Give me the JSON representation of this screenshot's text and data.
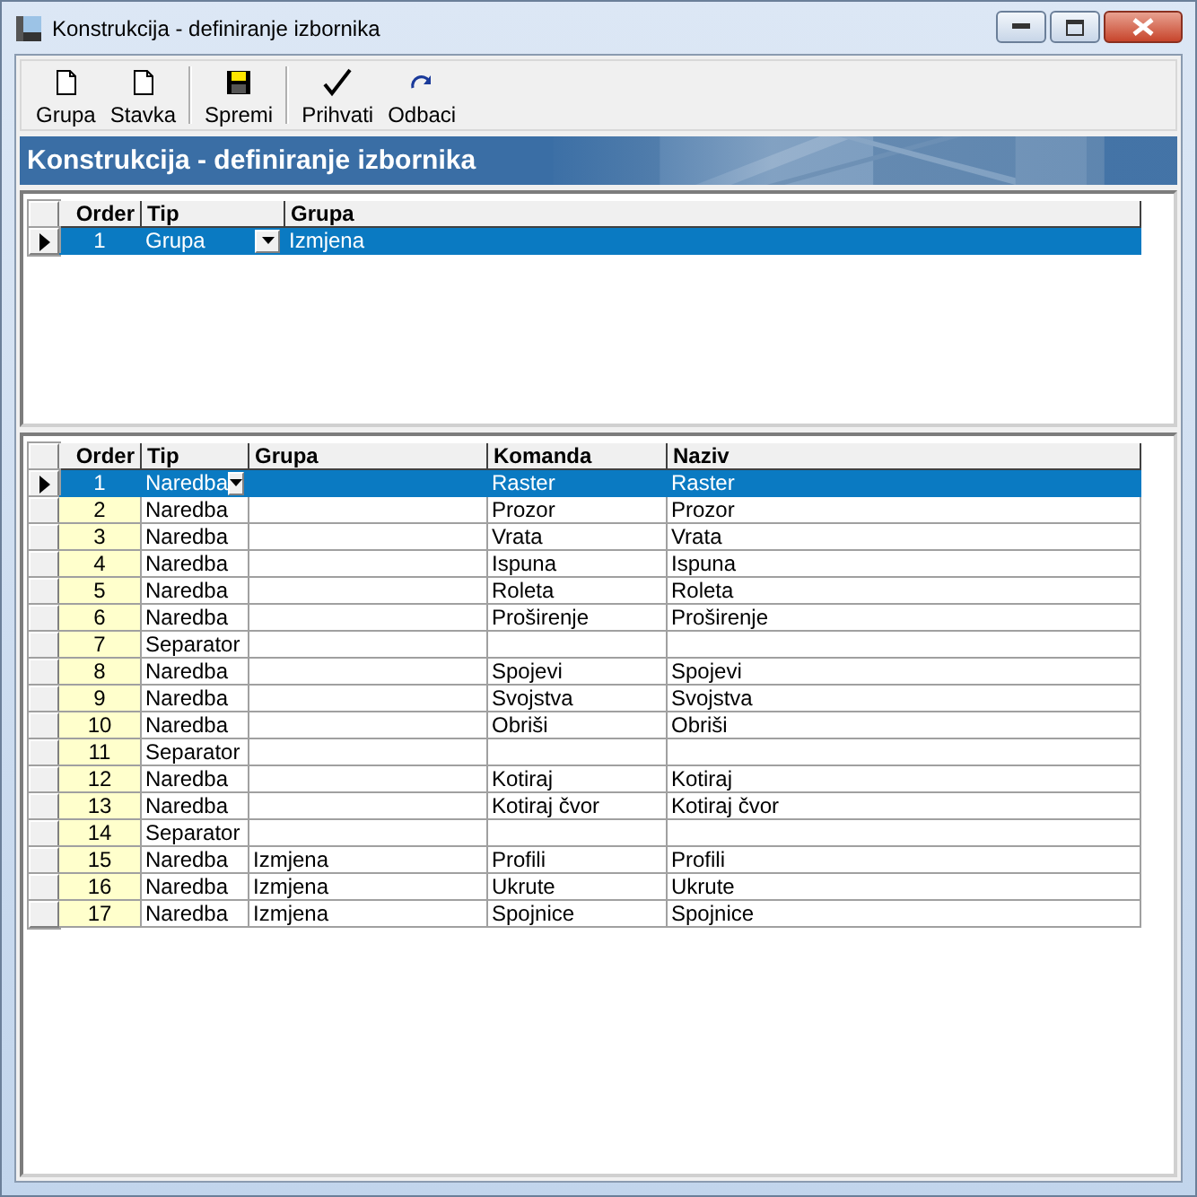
{
  "window": {
    "title": "Konstrukcija - definiranje izbornika"
  },
  "toolbar": [
    {
      "label": "Grupa",
      "kind": "new"
    },
    {
      "label": "Stavka",
      "kind": "new"
    },
    {
      "kind": "separator"
    },
    {
      "label": "Spremi",
      "kind": "save"
    },
    {
      "kind": "separator"
    },
    {
      "label": "Prihvati",
      "kind": "accept"
    },
    {
      "label": "Odbaci",
      "kind": "undo"
    }
  ],
  "banner": {
    "title": "Konstrukcija - definiranje izbornika"
  },
  "top_grid": {
    "columns": [
      "Order",
      "Tip",
      "Grupa"
    ],
    "rows": [
      {
        "cells": [
          "1",
          "Grupa",
          "Izmjena"
        ],
        "selected": true
      }
    ]
  },
  "bottom_grid": {
    "columns": [
      "Order",
      "Tip",
      "Grupa",
      "Komanda",
      "Naziv"
    ],
    "rows": [
      {
        "cells": [
          "1",
          "Naredba",
          null,
          "Raster",
          "Raster"
        ],
        "selected": true
      },
      {
        "cells": [
          "2",
          "Naredba",
          null,
          "Prozor",
          "Prozor"
        ],
        "selected": false
      },
      {
        "cells": [
          "3",
          "Naredba",
          null,
          "Vrata",
          "Vrata"
        ],
        "selected": false
      },
      {
        "cells": [
          "4",
          "Naredba",
          null,
          "Ispuna",
          "Ispuna"
        ],
        "selected": false
      },
      {
        "cells": [
          "5",
          "Naredba",
          null,
          "Roleta",
          "Roleta"
        ],
        "selected": false
      },
      {
        "cells": [
          "6",
          "Naredba",
          null,
          "Proširenje",
          "Proširenje"
        ],
        "selected": false
      },
      {
        "cells": [
          "7",
          "Separator",
          null,
          null,
          null
        ],
        "selected": false
      },
      {
        "cells": [
          "8",
          "Naredba",
          null,
          "Spojevi",
          "Spojevi"
        ],
        "selected": false
      },
      {
        "cells": [
          "9",
          "Naredba",
          null,
          "Svojstva",
          "Svojstva"
        ],
        "selected": false
      },
      {
        "cells": [
          "10",
          "Naredba",
          null,
          "Obriši",
          "Obriši"
        ],
        "selected": false
      },
      {
        "cells": [
          "11",
          "Separator",
          null,
          null,
          null
        ],
        "selected": false
      },
      {
        "cells": [
          "12",
          "Naredba",
          null,
          "Kotiraj",
          "Kotiraj"
        ],
        "selected": false
      },
      {
        "cells": [
          "13",
          "Naredba",
          null,
          "Kotiraj čvor",
          "Kotiraj čvor"
        ],
        "selected": false
      },
      {
        "cells": [
          "14",
          "Separator",
          null,
          null,
          null
        ],
        "selected": false
      },
      {
        "cells": [
          "15",
          "Naredba",
          "Izmjena",
          "Profili",
          "Profili"
        ],
        "selected": false
      },
      {
        "cells": [
          "16",
          "Naredba",
          "Izmjena",
          "Ukrute",
          "Ukrute"
        ],
        "selected": false
      },
      {
        "cells": [
          "17",
          "Naredba",
          "Izmjena",
          "Spojnice",
          "Spojnice"
        ],
        "selected": false
      }
    ]
  }
}
